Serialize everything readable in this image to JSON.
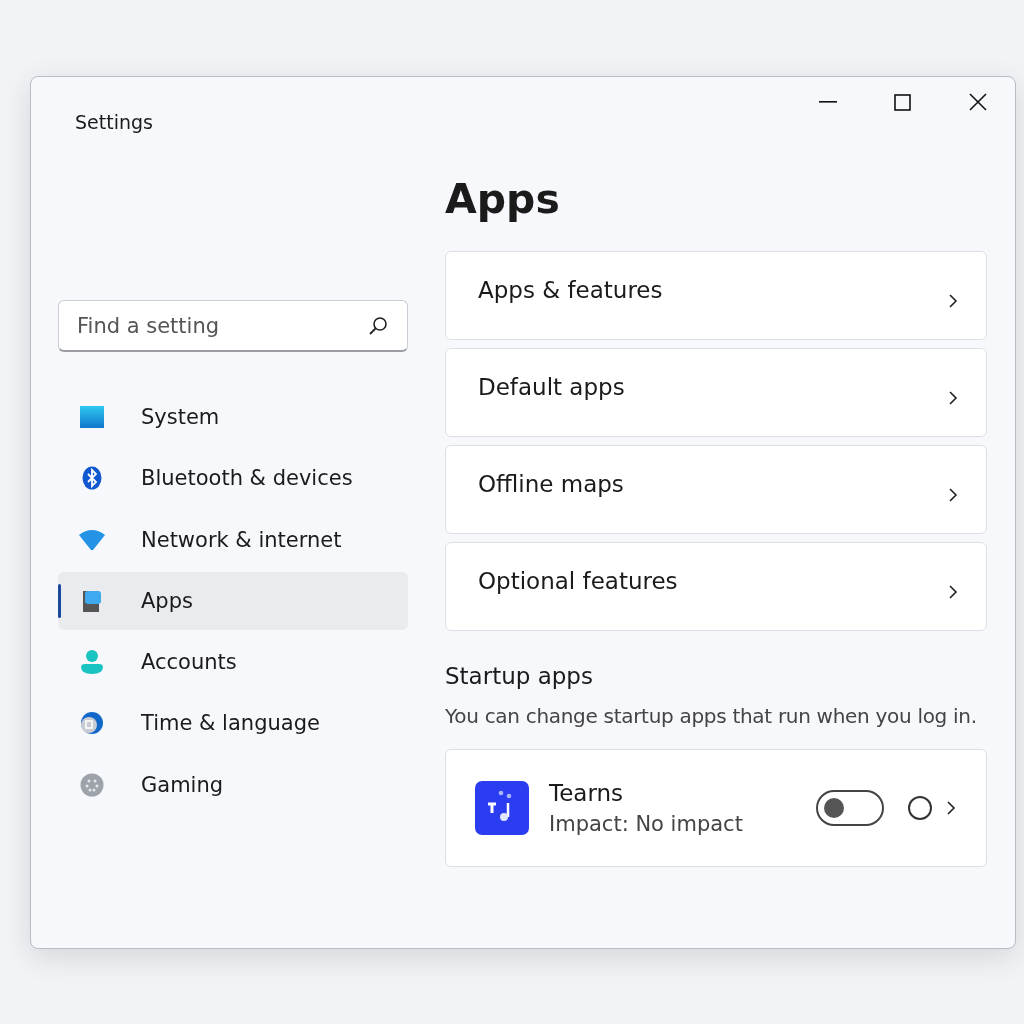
{
  "window": {
    "title": "Settings"
  },
  "search": {
    "placeholder": "Find a setting"
  },
  "sidebar": {
    "items": [
      {
        "label": "System",
        "selected": false
      },
      {
        "label": "Bluetooth & devices",
        "selected": false
      },
      {
        "label": "Network & internet",
        "selected": false
      },
      {
        "label": "Apps",
        "selected": true
      },
      {
        "label": "Accounts",
        "selected": false
      },
      {
        "label": "Time & language",
        "selected": false
      },
      {
        "label": "Gaming",
        "selected": false
      }
    ]
  },
  "page": {
    "title": "Apps",
    "links": [
      {
        "label": "Apps & features"
      },
      {
        "label": "Default apps"
      },
      {
        "label": "Offline maps"
      },
      {
        "label": "Optional features"
      }
    ],
    "startup": {
      "heading": "Startup apps",
      "description": "You can change startup apps that run when you log in.",
      "apps": [
        {
          "name": "Tearns",
          "impact": "Impact: No impact",
          "on": false,
          "checked": false
        }
      ]
    }
  }
}
